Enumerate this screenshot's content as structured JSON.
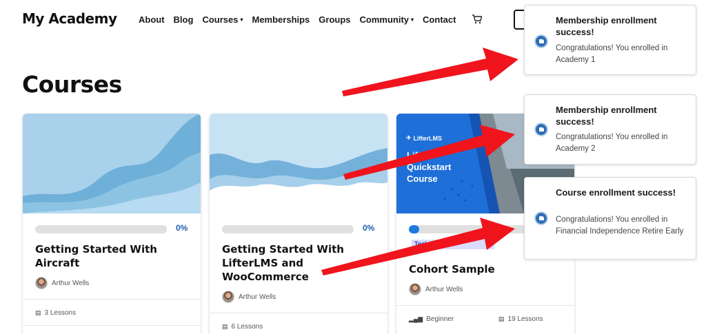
{
  "header": {
    "brand": "My Academy",
    "nav": [
      {
        "label": "About",
        "dropdown": false
      },
      {
        "label": "Blog",
        "dropdown": false
      },
      {
        "label": "Courses",
        "dropdown": true
      },
      {
        "label": "Memberships",
        "dropdown": false
      },
      {
        "label": "Groups",
        "dropdown": false
      },
      {
        "label": "Community",
        "dropdown": true
      },
      {
        "label": "Contact",
        "dropdown": false
      }
    ],
    "cart_icon": "cart-icon",
    "chevron": "⌄"
  },
  "page": {
    "title": "Courses"
  },
  "courses": [
    {
      "title": "Getting Started With Aircraft",
      "progress_pct": 0,
      "progress_label": "0%",
      "author": "Arthur Wells",
      "lessons": "3 Lessons"
    },
    {
      "title": "Getting Started With LifterLMS and WooCommerce",
      "progress_pct": 0,
      "progress_label": "0%",
      "author": "Arthur Wells",
      "lessons": "6 Lessons"
    },
    {
      "title": "Cohort Sample",
      "progress_pct": 8,
      "author": "Arthur Wells",
      "tag": "Technology",
      "level": "Beginner",
      "lessons": "19 Lessons",
      "hero": {
        "brand": "LifterLMS",
        "line1": "Lift",
        "line2": "Quickstart",
        "line3": "Course"
      }
    }
  ],
  "toasts": [
    {
      "title": "Membership enrollment success!",
      "message": "Congratulations! You enrolled in Academy 1"
    },
    {
      "title": "Membership enrollment success!",
      "message": "Congratulations! You enrolled in Academy 2"
    },
    {
      "title": "Course enrollment success!",
      "message": "Congratulations! You enrolled in Financial Independence Retire Early"
    }
  ],
  "colors": {
    "accent": "#1f7ae0",
    "arrow": "#f0141c",
    "toast_icon": "#2f6fb4"
  }
}
